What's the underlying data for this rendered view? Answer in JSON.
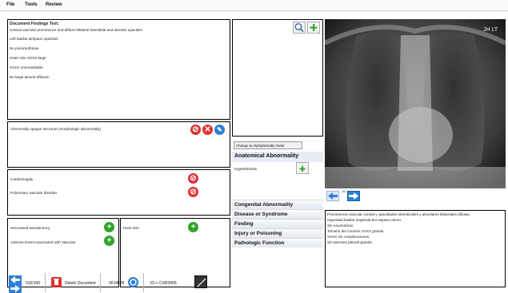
{
  "menu": [
    "File",
    "Tools",
    "Review"
  ],
  "findings": {
    "title": "Document Findings Text:",
    "lines": [
      "Central vascular prominence and diffuse bilateral interstitial and alveolar opacities",
      "Left basilar airspace opacities",
      "No pneumothorax",
      "Heart size XXXX large",
      "XXXX unremarkable",
      "No large pleural effusion"
    ]
  },
  "abnormal_structure": {
    "label": "Abnormally opaque structure (morphologic abnormality)"
  },
  "findings_list_a": [
    "Cardiomegaly",
    "Pulmonary vascular disorder"
  ],
  "findings_list_b": [
    "Decreased translucency",
    "Adverse Event Associated with Vascular"
  ],
  "heart_size": {
    "label": "heart size"
  },
  "category": {
    "change_order_label": "Change to Alphabetically Order",
    "anatomical_title": "Anatomical Abnormality",
    "anatomical_item": "Hypertelorism",
    "anatomical_count": "1",
    "categories": [
      "Congenital Abnormality",
      "Disease or Syndrome",
      "Finding",
      "Injury or Poisoning",
      "Pathologic Function"
    ]
  },
  "image": {
    "overlay": "JH LT",
    "page": "1/2"
  },
  "translation": {
    "lines": [
      "Prominencia vascular central y opacidades intersticiales y alveolares bilaterales difusas.",
      "Opacidad basilar izquierda del espacio aéreo.",
      "Sin neumotórax.",
      "Tamaño del corazón XXXX grande.",
      "XXXX sin complicaciones.",
      "Sin derrame pleural grande."
    ]
  },
  "bottom": {
    "counter": "010/100",
    "delete_label": "Delete Document",
    "timer": "00:04:35",
    "doc_id": "ID-> CXR3405"
  },
  "colors": {
    "accent": "#2f7fd6",
    "danger": "#d33",
    "success": "#2fa62a"
  }
}
